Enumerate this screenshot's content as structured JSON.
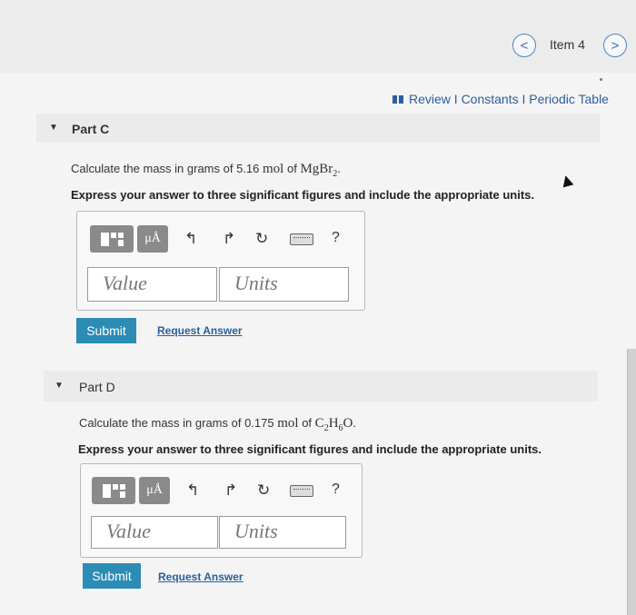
{
  "nav": {
    "prev_symbol": "<",
    "next_symbol": ">",
    "item_label": "Item 4"
  },
  "links": {
    "text": "Review I Constants I Periodic Table"
  },
  "part_c": {
    "title": "Part C",
    "question_prefix": "Calculate the mass in grams of 5.16",
    "question_unit": "mol",
    "question_mid": "of",
    "question_formula": "MgBr",
    "formula_sub": "2",
    "question_end": ".",
    "instruction": "Express your answer to three significant figures and include the appropriate units.",
    "value_placeholder": "Value",
    "units_placeholder": "Units",
    "submit_label": "Submit",
    "request_label": "Request Answer"
  },
  "part_d": {
    "title": "Part D",
    "question_prefix": "Calculate the mass in grams of 0.175",
    "question_unit": "mol",
    "question_mid": "of",
    "formula_c": "C",
    "formula_c_sub": "2",
    "formula_h": "H",
    "formula_h_sub": "6",
    "formula_o": "O",
    "question_end": ".",
    "instruction": "Express your answer to three significant figures and include the appropriate units.",
    "value_placeholder": "Value",
    "units_placeholder": "Units",
    "submit_label": "Submit",
    "request_label": "Request Answer"
  },
  "toolbar": {
    "mu_label": "μÅ",
    "undo_symbol": "↰",
    "redo_symbol": "↱",
    "reset_symbol": "↻",
    "help_symbol": "?"
  },
  "colors": {
    "accent": "#2c8cb6",
    "link": "#2a5f9e"
  }
}
